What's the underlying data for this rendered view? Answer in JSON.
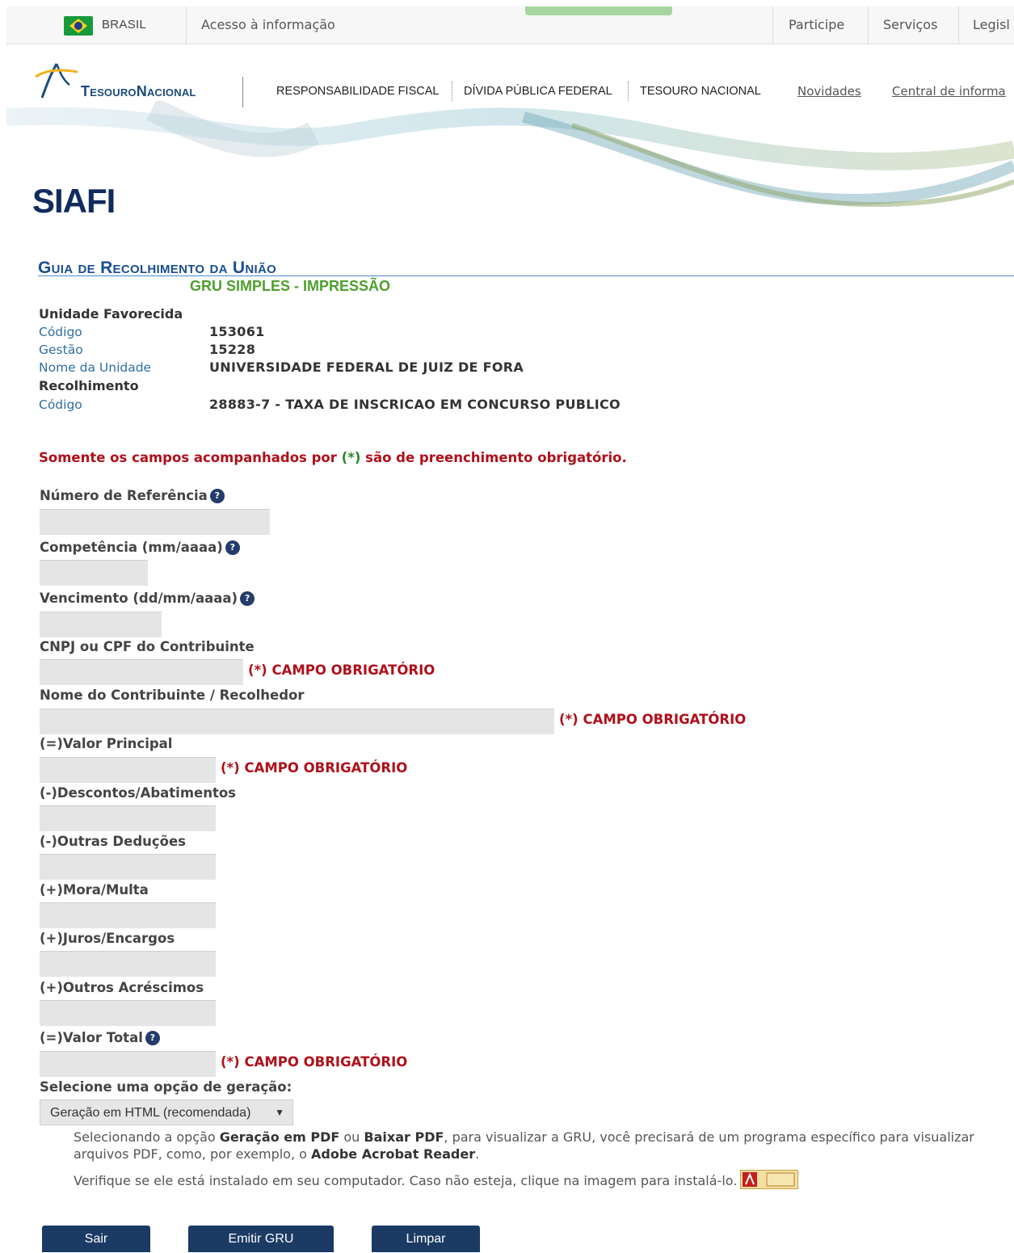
{
  "govbar": {
    "country": "BRASIL",
    "access": "Acesso à informação",
    "links": [
      "Participe",
      "Serviços",
      "Legisl"
    ]
  },
  "header": {
    "logo_part1": "Tesouro",
    "logo_part2": "Nacional",
    "nav": [
      "RESPONSABILIDADE FISCAL",
      "DÍVIDA PÚBLICA FEDERAL",
      "TESOURO NACIONAL"
    ],
    "links": [
      "Novidades",
      "Central de informa"
    ],
    "system": "SIAFI"
  },
  "page": {
    "title": "Guia de Recolhimento da União",
    "subtitle": "GRU SIMPLES - IMPRESSÃO"
  },
  "unidade": {
    "heading": "Unidade Favorecida",
    "codigo_label": "Código",
    "codigo": "153061",
    "gestao_label": "Gestão",
    "gestao": "15228",
    "nome_label": "Nome da Unidade",
    "nome": "UNIVERSIDADE FEDERAL DE JUIZ DE FORA"
  },
  "recolhimento": {
    "heading": "Recolhimento",
    "codigo_label": "Código",
    "codigo": "28883-7 - TAXA DE INSCRICAO EM CONCURSO PUBLICO"
  },
  "notice": {
    "before": "Somente os campos acompanhados por ",
    "marker": "(*)",
    "after": " são de preenchimento obrigatório."
  },
  "fields": {
    "referencia": "Número de Referência",
    "competencia": "Competência (mm/aaaa)",
    "vencimento": "Vencimento (dd/mm/aaaa)",
    "cnpj": "CNPJ ou CPF do Contribuinte",
    "nome": "Nome do Contribuinte / Recolhedor",
    "valor_principal": "(=)Valor Principal",
    "descontos": "(-)Descontos/Abatimentos",
    "outras_deducoes": "(-)Outras Deduções",
    "mora": "(+)Mora/Multa",
    "juros": "(+)Juros/Encargos",
    "outros_acrescimos": "(+)Outros Acréscimos",
    "valor_total": "(=)Valor Total"
  },
  "required_label": "(*) CAMPO OBRIGATÓRIO",
  "help_glyph": "?",
  "generation": {
    "label": "Selecione uma opção de geração:",
    "selected": "Geração em HTML (recomendada)",
    "info1_a": "Selecionando a opção ",
    "info1_b": "Geração em PDF",
    "info1_c": " ou ",
    "info1_d": "Baixar PDF",
    "info1_e": ", para visualizar a GRU, você precisará de um programa específico para visualizar arquivos PDF, como, por exemplo, o ",
    "info1_f": "Adobe Acrobat Reader",
    "info1_g": ".",
    "info2": "Verifique se ele está instalado em seu computador. Caso não esteja, clique na imagem para instalá-lo."
  },
  "buttons": {
    "sair": "Sair",
    "emitir": "Emitir GRU",
    "limpar": "Limpar"
  },
  "colors": {
    "navy": "#1b3a64",
    "required_red": "#b0101a",
    "subtitle_green": "#4e9f2d",
    "title_blue": "#1a4e8f"
  }
}
